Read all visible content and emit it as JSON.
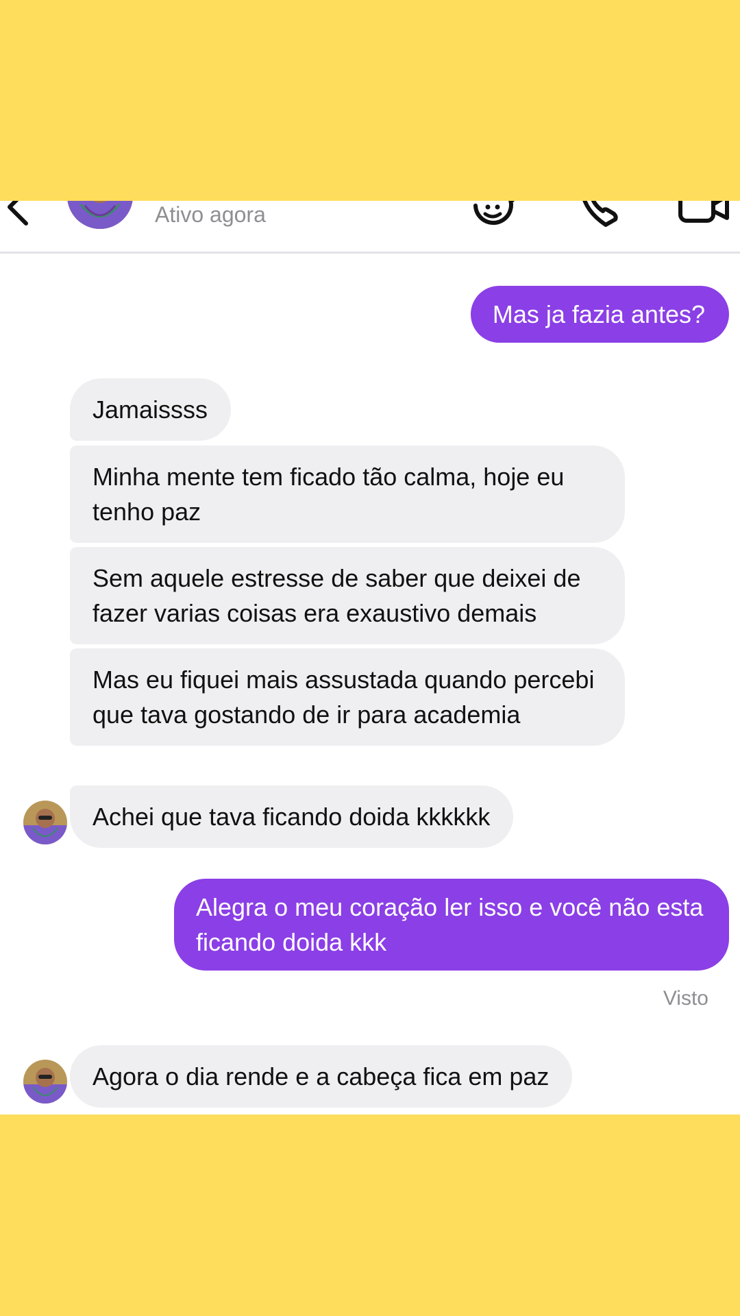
{
  "header": {
    "status": "Ativo agora",
    "icons": [
      "back-icon",
      "avatar",
      "sticker-icon",
      "phone-call-icon",
      "video-camera-icon"
    ]
  },
  "messages": [
    {
      "side": "out",
      "text": "Mas ja fazia antes?"
    },
    {
      "side": "in",
      "text": "Jamaissss"
    },
    {
      "side": "in",
      "text": "Minha mente tem ficado tão calma, hoje eu tenho paz"
    },
    {
      "side": "in",
      "text": "Sem aquele estresse de saber que deixei de fazer varias coisas era exaustivo demais"
    },
    {
      "side": "in",
      "text": "Mas eu fiquei mais assustada quando percebi que tava gostando de ir para academia"
    },
    {
      "side": "in",
      "text": "Achei que tava ficando doida kkkkkk"
    },
    {
      "side": "out",
      "text": "Alegra o meu coração ler isso e você não esta ficando doida kkk"
    },
    {
      "side": "in",
      "text": "Agora o dia rende e a cabeça fica em paz"
    }
  ],
  "seen_label": "Visto",
  "colors": {
    "band": "#FEDD5C",
    "outgoing_bubble": "#8B3FE6",
    "incoming_bubble": "#EFEFF1",
    "muted_text": "#8E8E93"
  }
}
